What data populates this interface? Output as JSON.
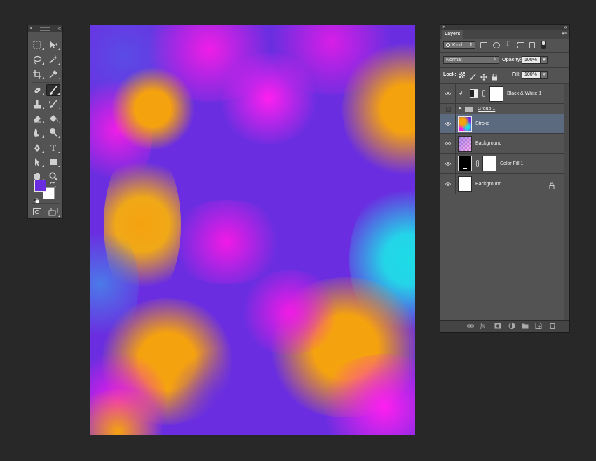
{
  "toolbar": {
    "close_glyph": "×",
    "collapse_glyph": "«",
    "tools": [
      {
        "name": "marquee-tool-icon",
        "icon": "marquee-icon"
      },
      {
        "name": "move-tool-icon",
        "icon": "move-icon"
      },
      {
        "name": "lasso-tool-icon",
        "icon": "lasso-icon"
      },
      {
        "name": "magic-wand-tool-icon",
        "icon": "magic-wand-icon"
      },
      {
        "name": "crop-tool-icon",
        "icon": "crop-icon"
      },
      {
        "name": "eyedropper-tool-icon",
        "icon": "eyedropper-icon"
      },
      {
        "name": "healing-brush-tool-icon",
        "icon": "bandage-icon"
      },
      {
        "name": "brush-tool-icon",
        "icon": "brush-icon",
        "active": true
      },
      {
        "name": "clone-stamp-tool-icon",
        "icon": "stamp-icon"
      },
      {
        "name": "history-brush-tool-icon",
        "icon": "history-brush-icon"
      },
      {
        "name": "eraser-tool-icon",
        "icon": "eraser-icon"
      },
      {
        "name": "paint-bucket-tool-icon",
        "icon": "bucket-icon"
      },
      {
        "name": "smudge-tool-icon",
        "icon": "smudge-icon"
      },
      {
        "name": "dodge-tool-icon",
        "icon": "dodge-icon"
      },
      {
        "name": "pen-tool-icon",
        "icon": "pen-icon"
      },
      {
        "name": "type-tool-icon",
        "icon": "type-icon"
      },
      {
        "name": "path-selection-tool-icon",
        "icon": "arrow-icon"
      },
      {
        "name": "rectangle-tool-icon",
        "icon": "rectangle-icon"
      },
      {
        "name": "hand-tool-icon",
        "icon": "hand-icon"
      },
      {
        "name": "zoom-tool-icon",
        "icon": "zoom-icon"
      }
    ],
    "type_glyph": "T",
    "foreground_color": "#6a2ee0",
    "background_color": "#ffffff"
  },
  "canvas": {
    "colors": {
      "purple": "#6a2ee0",
      "magenta": "#f21ae6",
      "orange": "#f5a20f",
      "cyan": "#1ddce6",
      "blue": "#4c5ee8"
    }
  },
  "layers_panel": {
    "close_glyph": "×",
    "collapse_glyph": "«",
    "menu_glyph": "▾≡",
    "tab": "Layers",
    "filter": {
      "label": "Kind",
      "arrow": "⇕"
    },
    "blend_mode": {
      "value": "Normal",
      "arrow": "⇕"
    },
    "opacity": {
      "label": "Opacity:",
      "value": "100%",
      "arrow": "▾"
    },
    "lock_label": "Lock:",
    "fill": {
      "label": "Fill:",
      "value": "100%",
      "arrow": "▾"
    },
    "layers": [
      {
        "name": "Black & White 1",
        "visible": true,
        "type": "adjustment",
        "clipped": true
      },
      {
        "name": "Group 1",
        "visible": false,
        "type": "group"
      },
      {
        "name": "Stroke",
        "visible": true,
        "type": "raster",
        "selected": true
      },
      {
        "name": "Background",
        "visible": true,
        "type": "raster-transparent"
      },
      {
        "name": "Color Fill 1",
        "visible": true,
        "type": "fill"
      },
      {
        "name": "Background",
        "visible": true,
        "type": "background",
        "locked": true
      }
    ],
    "clip_glyph": "↲",
    "expand_glyph": "▶",
    "bottom_icons": [
      "link-layers-icon",
      "fx-icon",
      "add-mask-icon",
      "adjustment-layer-icon",
      "new-group-icon",
      "new-layer-icon",
      "trash-icon"
    ],
    "fx_label": "fx"
  }
}
